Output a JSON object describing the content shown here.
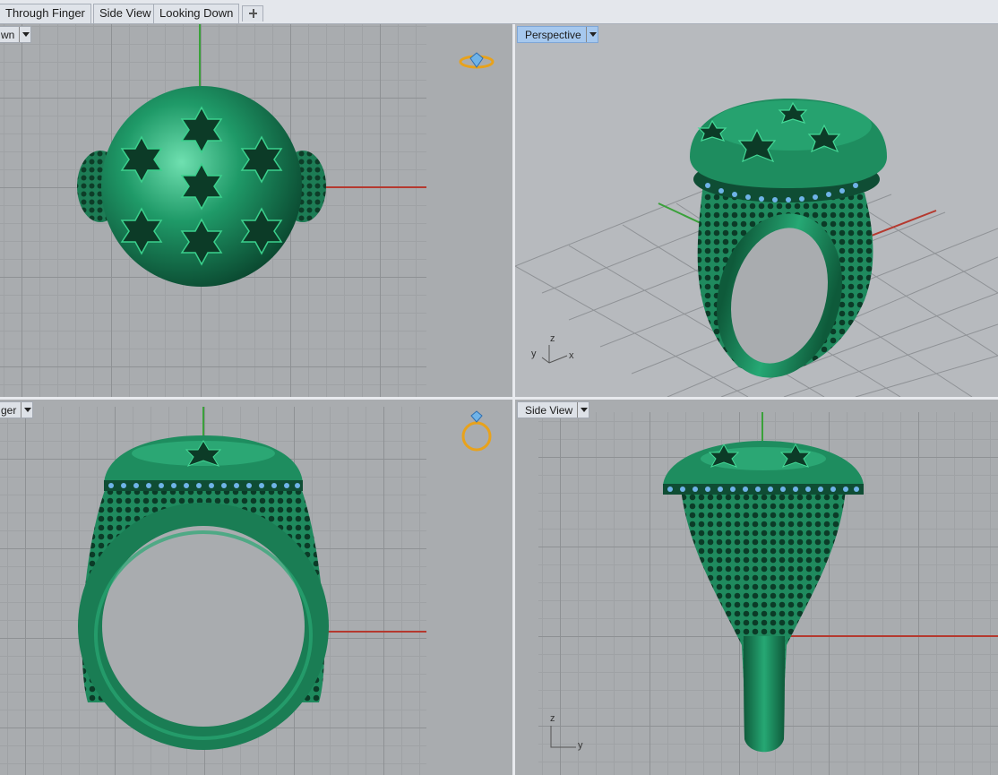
{
  "tabs": [
    {
      "label": "Through Finger"
    },
    {
      "label": "Side View"
    },
    {
      "label": "Looking Down"
    }
  ],
  "add_tab_icon": "plus-icon",
  "viewports": {
    "top_left": {
      "label": "wn"
    },
    "top_right": {
      "label": "Perspective"
    },
    "bottom_left": {
      "label": "ger"
    },
    "bottom_right": {
      "label": "Side View"
    }
  },
  "axis_labels": {
    "perspective": {
      "z": "z",
      "y": "y",
      "x": "x"
    },
    "side": {
      "z": "z",
      "y": "y"
    }
  },
  "colors": {
    "model": "#1f8a5e",
    "gems": "#6fb3e8",
    "x_axis": "#b5392f",
    "y_axis": "#3aa13a",
    "viewport_bg": "#a9acaf",
    "active_label": "#a6c8ee"
  }
}
